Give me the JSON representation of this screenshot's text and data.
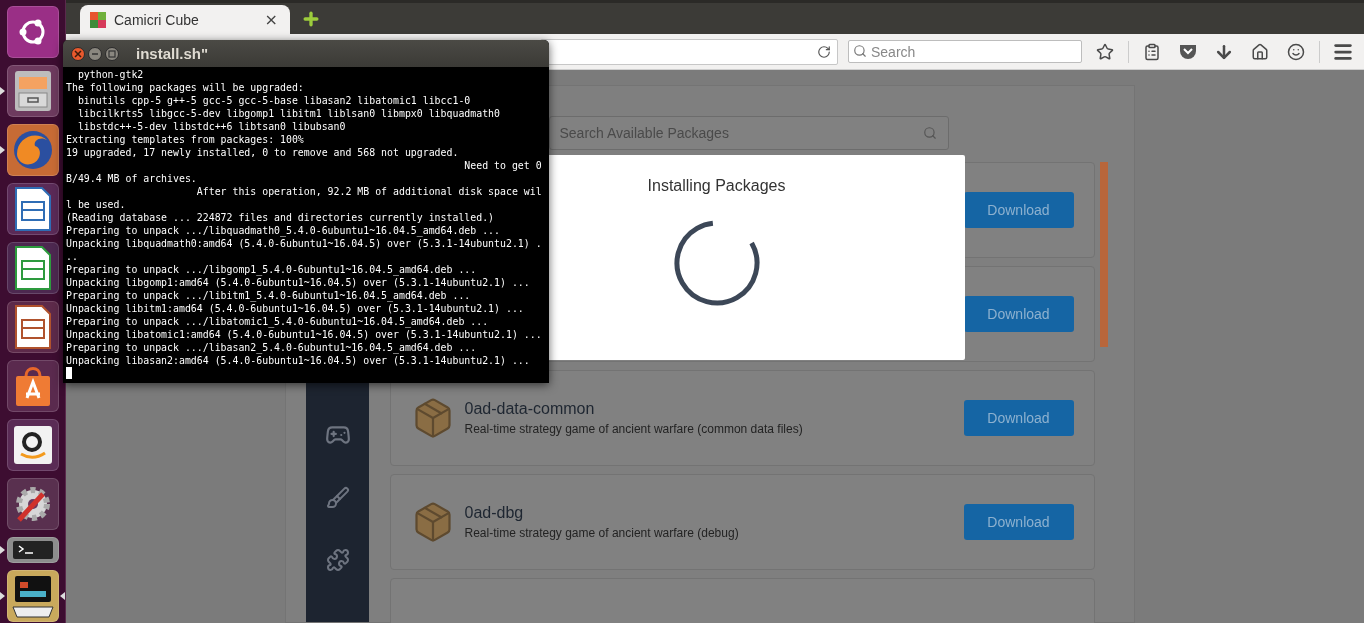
{
  "launcher": [
    {
      "kind": "dash",
      "running": false,
      "focused": false
    },
    {
      "kind": "files",
      "running": true,
      "focused": false
    },
    {
      "kind": "firefox",
      "running": true,
      "focused": false
    },
    {
      "kind": "writer",
      "running": false,
      "focused": false
    },
    {
      "kind": "calc",
      "running": false,
      "focused": false
    },
    {
      "kind": "impress",
      "running": false,
      "focused": false
    },
    {
      "kind": "software",
      "running": false,
      "focused": false
    },
    {
      "kind": "amazon",
      "running": false,
      "focused": false
    },
    {
      "kind": "settings",
      "running": false,
      "focused": false
    },
    {
      "kind": "terminal",
      "running": true,
      "focused": false
    },
    {
      "kind": "xterm",
      "running": true,
      "focused": true
    }
  ],
  "browser": {
    "tabs": [
      {
        "title": "Camicri Cube",
        "close": "×",
        "selected": true
      }
    ],
    "search": {
      "placeholder": "Search"
    }
  },
  "page": {
    "search": {
      "placeholder": "Search Available Packages"
    },
    "packages": [
      {
        "kind": "covered",
        "button": "Download"
      },
      {
        "kind": "covered",
        "button": "Download"
      },
      {
        "kind": "full",
        "name": "0ad-data-common",
        "description": "Real-time strategy game of ancient warfare (common data files)",
        "button": "Download"
      },
      {
        "kind": "full",
        "name": "0ad-dbg",
        "description": "Real-time strategy game of ancient warfare (debug)",
        "button": "Download"
      },
      {
        "kind": "cut"
      }
    ],
    "modal": {
      "title": "Installing Packages"
    }
  },
  "terminal": {
    "title": "install.sh\"",
    "lines": [
      "  python-gtk2",
      "The following packages will be upgraded:",
      "  binutils cpp-5 g++-5 gcc-5 gcc-5-base libasan2 libatomic1 libcc1-0",
      "  libcilkrts5 libgcc-5-dev libgomp1 libitm1 liblsan0 libmpx0 libquadmath0",
      "  libstdc++-5-dev libstdc++6 libtsan0 libubsan0",
      "Extracting templates from packages: 100%",
      "19 upgraded, 17 newly installed, 0 to remove and 568 not upgraded.",
      "                                                                   Need to get 0",
      "B/49.4 MB of archives.",
      "                      After this operation, 92.2 MB of additional disk space wil",
      "l be used.",
      "(Reading database ... 224872 files and directories currently installed.)",
      "Preparing to unpack .../libquadmath0_5.4.0-6ubuntu1~16.04.5_amd64.deb ...",
      "Unpacking libquadmath0:amd64 (5.4.0-6ubuntu1~16.04.5) over (5.3.1-14ubuntu2.1) .",
      "..",
      "Preparing to unpack .../libgomp1_5.4.0-6ubuntu1~16.04.5_amd64.deb ...",
      "Unpacking libgomp1:amd64 (5.4.0-6ubuntu1~16.04.5) over (5.3.1-14ubuntu2.1) ...",
      "Preparing to unpack .../libitm1_5.4.0-6ubuntu1~16.04.5_amd64.deb ...",
      "Unpacking libitm1:amd64 (5.4.0-6ubuntu1~16.04.5) over (5.3.1-14ubuntu2.1) ...",
      "Preparing to unpack .../libatomic1_5.4.0-6ubuntu1~16.04.5_amd64.deb ...",
      "Unpacking libatomic1:amd64 (5.4.0-6ubuntu1~16.04.5) over (5.3.1-14ubuntu2.1) ...",
      "Preparing to unpack .../libasan2_5.4.0-6ubuntu1~16.04.5_amd64.deb ...",
      "Unpacking libasan2:amd64 (5.4.0-6ubuntu1~16.04.5) over (5.3.1-14ubuntu2.1) ..."
    ]
  }
}
